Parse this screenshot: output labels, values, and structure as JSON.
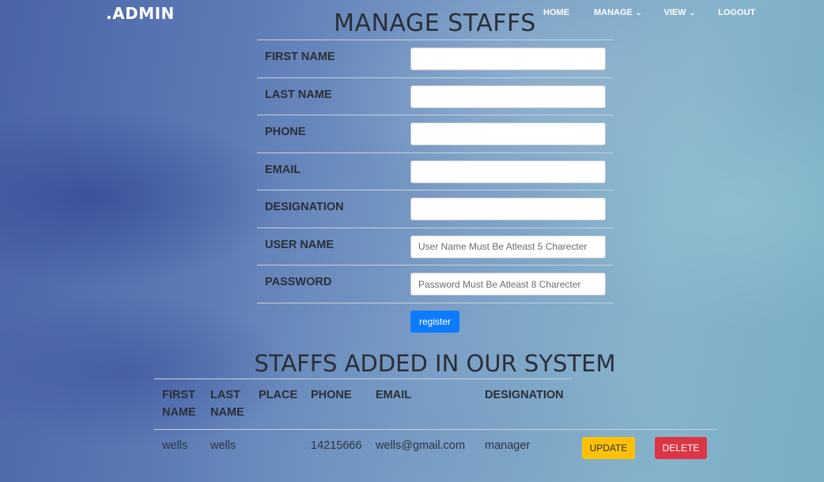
{
  "brand": ".ADMIN",
  "nav": {
    "home": "HOME",
    "manage": "MANAGE",
    "view": "VIEW",
    "logout": "LOGOUT",
    "chevron": "⌄"
  },
  "form": {
    "title": "MANAGE STAFFS",
    "fields": [
      {
        "label": "FIRST NAME",
        "value": "",
        "placeholder": ""
      },
      {
        "label": "LAST NAME",
        "value": "",
        "placeholder": ""
      },
      {
        "label": "PHONE",
        "value": "",
        "placeholder": ""
      },
      {
        "label": "EMAIL",
        "value": "",
        "placeholder": ""
      },
      {
        "label": "DESIGNATION",
        "value": "",
        "placeholder": ""
      },
      {
        "label": "USER NAME",
        "value": "",
        "placeholder": "User Name Must Be Atleast 5 Charecter"
      },
      {
        "label": "PASSWORD",
        "value": "",
        "placeholder": "Password Must Be Atleast 8 Charecter"
      }
    ],
    "register_label": "register"
  },
  "staff": {
    "title": "STAFFS ADDED IN OUR SYSTEM",
    "columns": {
      "first_name": "FIRST\nNAME",
      "last_name": "LAST\nNAME",
      "place": "PLACE",
      "phone": "PHONE",
      "email": "EMAIL",
      "designation": "DESIGNATION"
    },
    "rows": [
      {
        "first_name": "wells",
        "last_name": "wells",
        "place": "",
        "phone": "14215666",
        "email": "wells@gmail.com",
        "designation": "manager",
        "update_label": "UPDATE",
        "delete_label": "DELETE"
      }
    ]
  },
  "colors": {
    "primary_button": "#0d7bff",
    "update_button": "#ffc107",
    "delete_button": "#dc3545"
  }
}
